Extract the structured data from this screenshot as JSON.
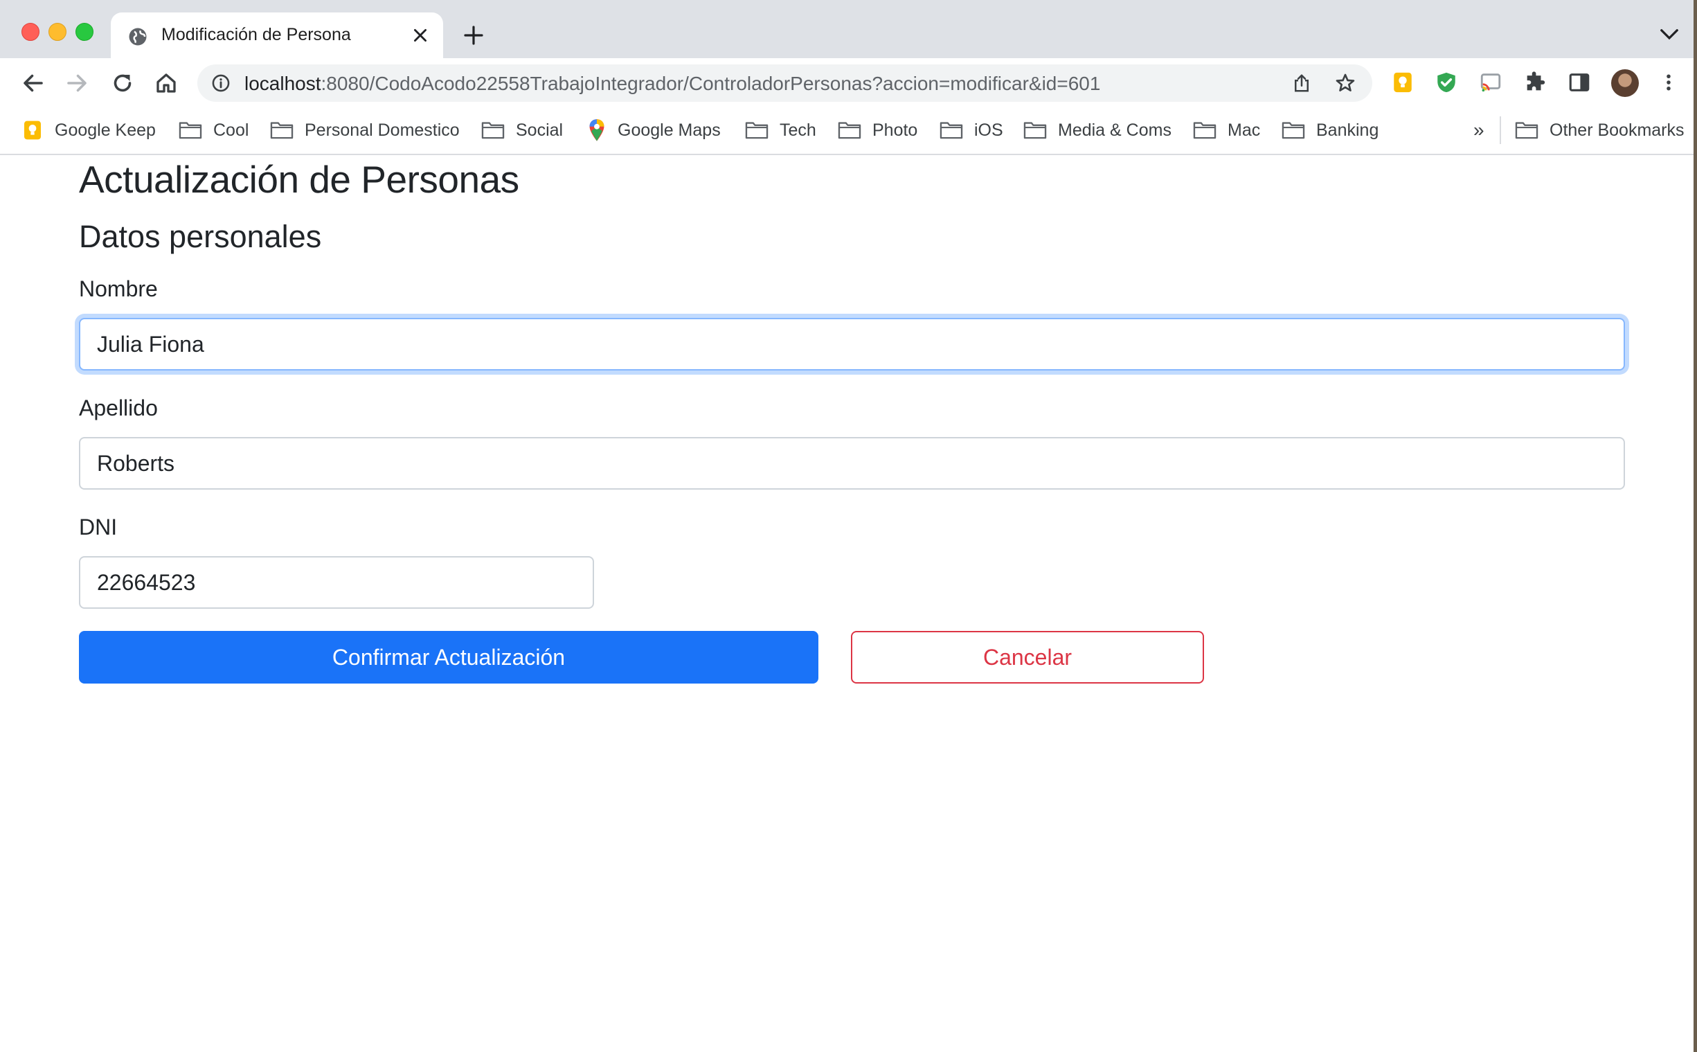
{
  "browser": {
    "tab_title": "Modificación de Persona",
    "url_host": "localhost",
    "url_rest": ":8080/CodoAcodo22558TrabajoIntegrador/ControladorPersonas?accion=modificar&id=601"
  },
  "bookmarks": [
    {
      "label": "Google Keep",
      "icon": "google-keep-icon"
    },
    {
      "label": "Cool",
      "icon": "folder-icon"
    },
    {
      "label": "Personal Domestico",
      "icon": "folder-icon"
    },
    {
      "label": "Social",
      "icon": "folder-icon"
    },
    {
      "label": "Google Maps",
      "icon": "google-maps-icon"
    },
    {
      "label": "Tech",
      "icon": "folder-icon"
    },
    {
      "label": "Photo",
      "icon": "folder-icon"
    },
    {
      "label": "iOS",
      "icon": "folder-icon"
    },
    {
      "label": "Media & Coms",
      "icon": "folder-icon"
    },
    {
      "label": "Mac",
      "icon": "folder-icon"
    },
    {
      "label": "Banking",
      "icon": "folder-icon"
    }
  ],
  "bookmarks_more": "»",
  "other_bookmarks": "Other Bookmarks",
  "page": {
    "title": "Actualización de Personas",
    "section": "Datos personales",
    "fields": {
      "nombre": {
        "label": "Nombre",
        "value": "Julia Fiona"
      },
      "apellido": {
        "label": "Apellido",
        "value": "Roberts"
      },
      "dni": {
        "label": "DNI",
        "value": "22664523"
      }
    },
    "confirm_label": "Confirmar Actualización",
    "cancel_label": "Cancelar"
  },
  "colors": {
    "primary": "#1a73f8",
    "danger": "#dc3545",
    "focus": "#86b7fe",
    "tabstrip": "#dee1e6"
  }
}
